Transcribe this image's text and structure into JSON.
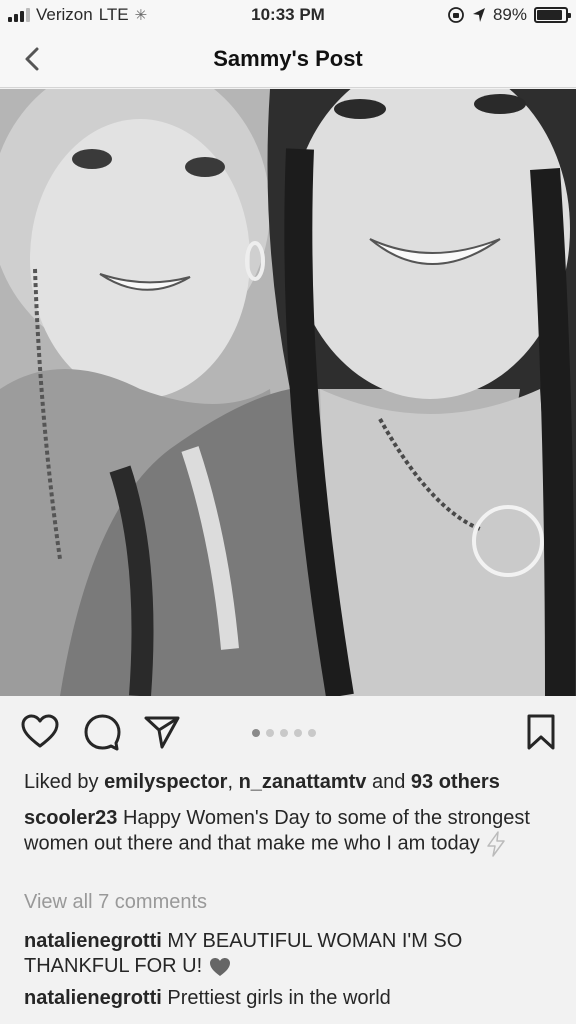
{
  "status_bar": {
    "carrier": "Verizon",
    "network": "LTE",
    "time": "10:33 PM",
    "battery": "89%",
    "battery_level": 0.89
  },
  "nav": {
    "title": "Sammy's Post"
  },
  "carousel": {
    "total": 5,
    "active": 1
  },
  "likes": {
    "prefix": "Liked by",
    "user1": "emilyspector",
    "sep": ",",
    "user2": "n_zanattamtv",
    "and": "and",
    "others": "93 others"
  },
  "caption": {
    "user": "scooler23",
    "text": "Happy Women's Day to some of the strongest women out there and that make me who I am today"
  },
  "view_all": "View all 7 comments",
  "comments": [
    {
      "user": "natalienegrotti",
      "text": "MY BEAUTIFUL WOMAN I'M SO THANKFUL FOR U!"
    },
    {
      "user": "natalienegrotti",
      "text": "Prettiest girls in the world"
    }
  ],
  "icons": {
    "back": "chevron-left-icon",
    "like": "heart-icon",
    "comment": "comment-bubble-icon",
    "share": "paper-plane-icon",
    "save": "bookmark-icon",
    "lightning": "lightning-icon",
    "heart_emoji": "heart-emoji-icon"
  }
}
